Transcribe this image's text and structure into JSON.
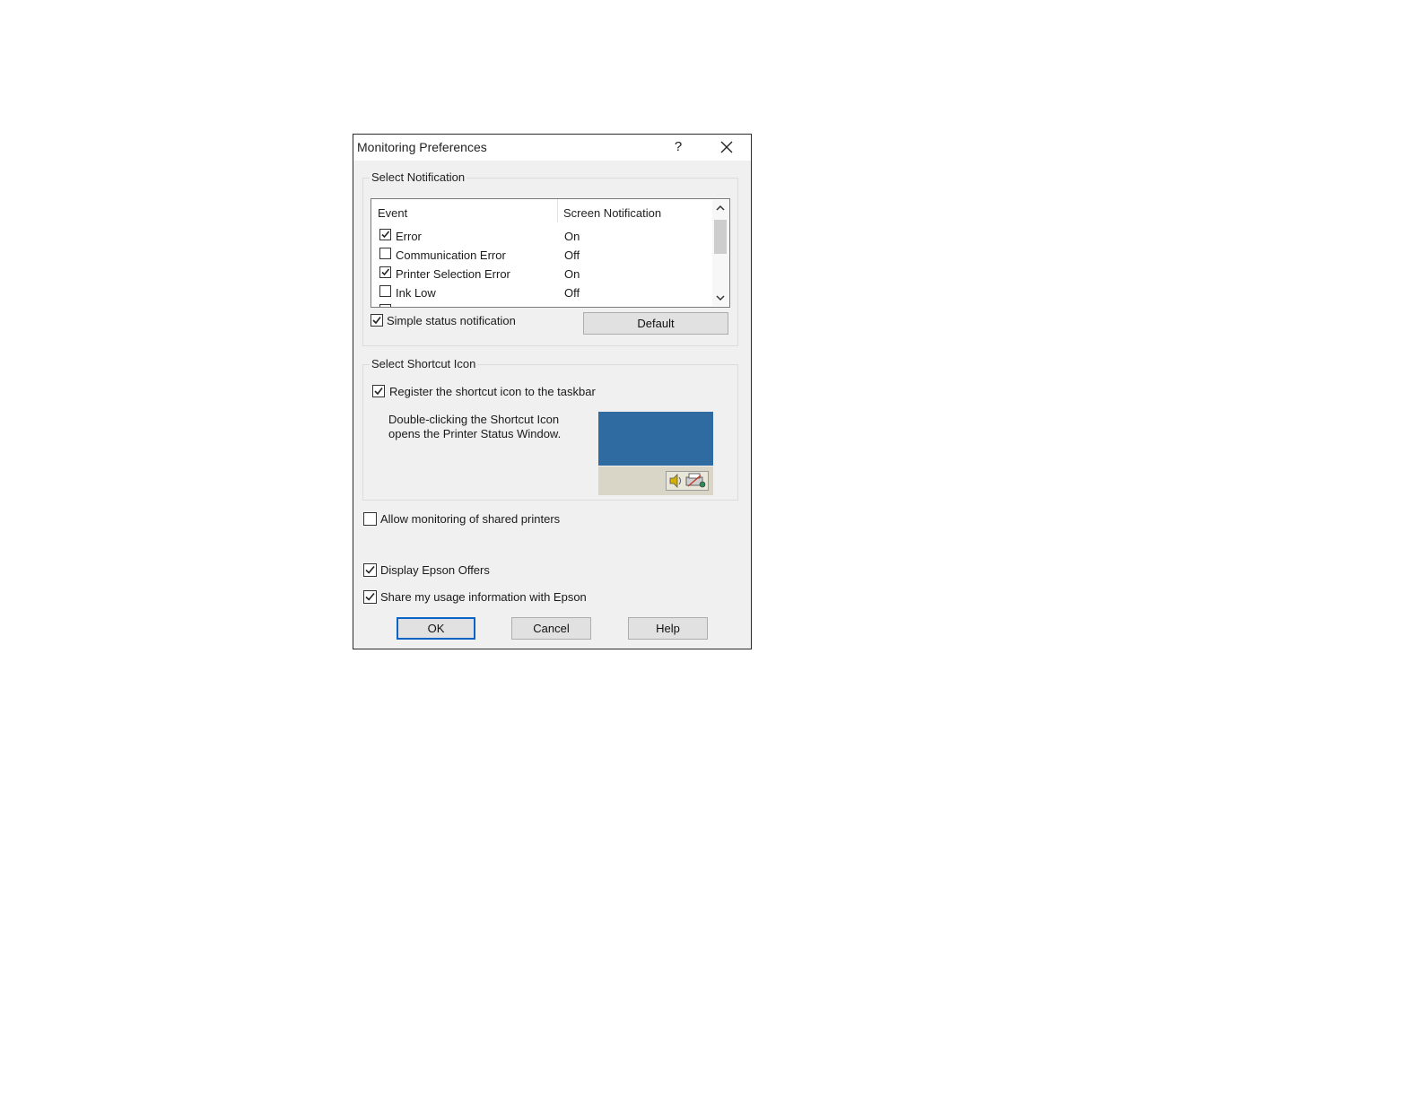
{
  "window": {
    "title": "Monitoring Preferences",
    "help_label": "?",
    "close_icon": "close-icon"
  },
  "select_notification": {
    "group_label": "Select Notification",
    "columns": [
      "Event",
      "Screen Notification"
    ],
    "rows": [
      {
        "event": "Error",
        "checked": true,
        "status": "On"
      },
      {
        "event": "Communication Error",
        "checked": false,
        "status": "Off"
      },
      {
        "event": "Printer Selection Error",
        "checked": true,
        "status": "On"
      },
      {
        "event": "Ink Low",
        "checked": false,
        "status": "Off"
      }
    ],
    "simple_status": {
      "label": "Simple status notification",
      "checked": true
    },
    "default_button": "Default"
  },
  "select_shortcut_icon": {
    "group_label": "Select Shortcut Icon",
    "register": {
      "label": "Register the shortcut icon to the taskbar",
      "checked": true
    },
    "description_line1": "Double-clicking the Shortcut Icon",
    "description_line2": "opens the Printer Status Window.",
    "preview_colors": {
      "screen": "#2f6ba0",
      "taskbar": "#d9d6c8"
    }
  },
  "options": {
    "allow_shared": {
      "label": "Allow monitoring of shared printers",
      "checked": false
    },
    "display_offers": {
      "label": "Display Epson Offers",
      "checked": true
    },
    "share_usage": {
      "label": "Share my usage information with Epson",
      "checked": true
    }
  },
  "buttons": {
    "ok": "OK",
    "cancel": "Cancel",
    "help": "Help"
  }
}
